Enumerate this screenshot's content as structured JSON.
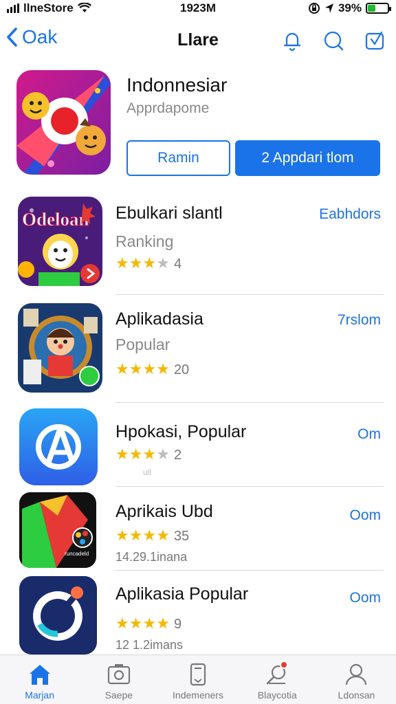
{
  "status_bar": {
    "carrier": "llneStore",
    "time": "1923M",
    "battery": "39%",
    "battery_level": 0.39
  },
  "nav": {
    "back_label": "Oak",
    "title": "Llare"
  },
  "featured": {
    "title": "Indonnesiar",
    "subtitle": "Apprdapome",
    "secondary_button": "Ramin",
    "primary_button": "2 Appdari tlom"
  },
  "apps": [
    {
      "name": "Ebulkari slantl",
      "category": "Ranking",
      "rating": 3,
      "rating_count": "4",
      "action": "Eabhdors"
    },
    {
      "name": "Aplikadasia",
      "category": "Popular",
      "rating": 4,
      "rating_count": "20",
      "action": "7rslom"
    },
    {
      "name": "Hpokasi, Popular",
      "rating": 3,
      "rating_count": "2",
      "subtext": "ull",
      "action": "Om"
    },
    {
      "name": "Aprikais Ubd",
      "rating": 4,
      "rating_count": "35",
      "subtext": "14.29.1inana",
      "action": "Oom"
    },
    {
      "name": "Aplikasia Popular",
      "rating": 4,
      "rating_count": "9",
      "subtext": "12 1.2imans",
      "action": "Oom"
    }
  ],
  "tabs": [
    {
      "label": "Marjan",
      "icon": "home-icon",
      "active": true
    },
    {
      "label": "Saepe",
      "icon": "photo-icon",
      "active": false
    },
    {
      "label": "Indemeners",
      "icon": "phone-icon",
      "active": false
    },
    {
      "label": "Blaycotia",
      "icon": "search-pin-icon",
      "active": false
    },
    {
      "label": "Ldonsan",
      "icon": "person-icon",
      "active": false
    }
  ],
  "colors": {
    "accent": "#1a73e8",
    "star": "#f5b800",
    "battery": "#1fb82e"
  }
}
